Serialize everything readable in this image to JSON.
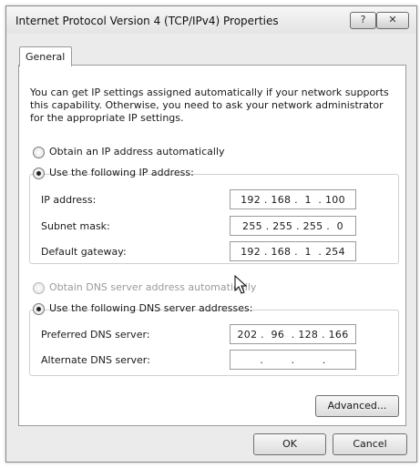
{
  "window": {
    "title": "Internet Protocol Version 4 (TCP/IPv4) Properties",
    "help_button": "?",
    "close_button": "✕"
  },
  "tabs": [
    {
      "label": "General",
      "selected": true
    }
  ],
  "intro_text": "You can get IP settings assigned automatically if your network supports this capability. Otherwise, you need to ask your network administrator for the appropriate IP settings.",
  "ip_section": {
    "auto_option": {
      "label": "Obtain an IP address automatically",
      "checked": false
    },
    "manual_option": {
      "label": "Use the following IP address:",
      "checked": true
    },
    "fields": [
      {
        "label": "IP address:",
        "value": "192 . 168 .  1  . 100"
      },
      {
        "label": "Subnet mask:",
        "value": "255 . 255 . 255 .  0"
      },
      {
        "label": "Default gateway:",
        "value": "192 . 168 .  1  . 254"
      }
    ]
  },
  "dns_section": {
    "auto_option": {
      "label": "Obtain DNS server address automatically",
      "checked": false,
      "disabled": true
    },
    "manual_option": {
      "label": "Use the following DNS server addresses:",
      "checked": true
    },
    "fields": [
      {
        "label": "Preferred DNS server:",
        "value": "202 .  96  . 128 . 166"
      },
      {
        "label": "Alternate DNS server:",
        "value": ".        .        ."
      }
    ]
  },
  "buttons": {
    "advanced": "Advanced...",
    "ok": "OK",
    "cancel": "Cancel"
  }
}
